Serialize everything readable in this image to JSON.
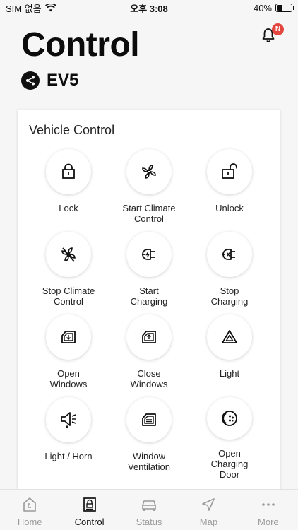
{
  "status_bar": {
    "carrier": "SIM 없음",
    "time": "오후 3:08",
    "battery_text": "40%",
    "battery_level": 0.4
  },
  "header": {
    "title": "Control",
    "notification_badge": "N",
    "vehicle_name": "EV5"
  },
  "card": {
    "title": "Vehicle Control",
    "controls": [
      {
        "label": "Lock",
        "icon": "lock-icon"
      },
      {
        "label": "Start Climate\nControl",
        "icon": "fan-icon"
      },
      {
        "label": "Unlock",
        "icon": "unlock-icon"
      },
      {
        "label": "Stop Climate\nControl",
        "icon": "fan-off-icon"
      },
      {
        "label": "Start\nCharging",
        "icon": "plug-charge-icon"
      },
      {
        "label": "Stop\nCharging",
        "icon": "plug-stop-icon"
      },
      {
        "label": "Open\nWindows",
        "icon": "window-open-icon"
      },
      {
        "label": "Close\nWindows",
        "icon": "window-close-icon"
      },
      {
        "label": "Light",
        "icon": "light-triangle-icon"
      },
      {
        "label": "Light / Horn",
        "icon": "horn-icon"
      },
      {
        "label": "Window\nVentilation",
        "icon": "window-vent-icon"
      },
      {
        "label": "Open\nCharging\nDoor",
        "icon": "charging-door-icon"
      }
    ]
  },
  "tabbar": {
    "tabs": [
      {
        "label": "Home",
        "icon": "home-icon",
        "active": false
      },
      {
        "label": "Control",
        "icon": "control-icon",
        "active": true
      },
      {
        "label": "Status",
        "icon": "car-icon",
        "active": false
      },
      {
        "label": "Map",
        "icon": "navigation-icon",
        "active": false
      },
      {
        "label": "More",
        "icon": "more-icon",
        "active": false
      }
    ]
  },
  "colors": {
    "background": "#f6f6f6",
    "badge": "#e2463f",
    "tab_active": "#111111",
    "tab_inactive": "#9a9a9a"
  }
}
